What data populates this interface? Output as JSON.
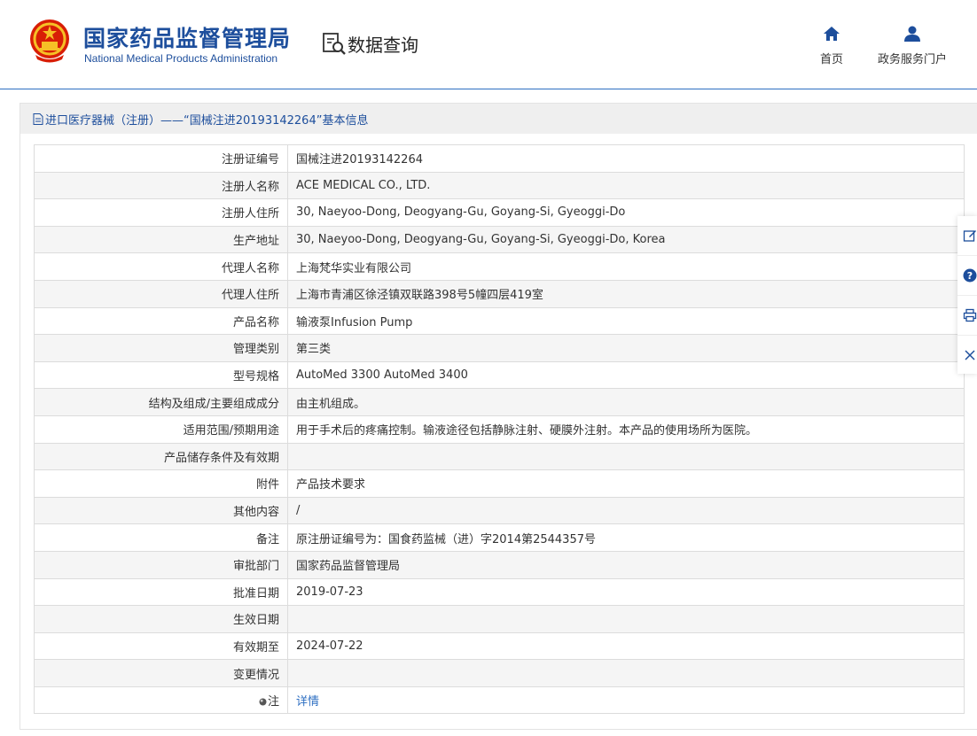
{
  "header": {
    "brand_cn": "国家药品监督管理局",
    "brand_en": "National Medical Products Administration",
    "query_label": "数据查询",
    "nav": [
      {
        "label": "首页",
        "icon": "home-icon"
      },
      {
        "label": "政务服务门户",
        "icon": "user-icon"
      }
    ]
  },
  "panel": {
    "title": "进口医疗器械（注册）——“国械注进20193142264”基本信息"
  },
  "rows": [
    {
      "label": "注册证编号",
      "value": "国械注进20193142264"
    },
    {
      "label": "注册人名称",
      "value": "ACE MEDICAL CO., LTD."
    },
    {
      "label": "注册人住所",
      "value": "30, Naeyoo-Dong, Deogyang-Gu, Goyang-Si, Gyeoggi-Do"
    },
    {
      "label": "生产地址",
      "value": "30, Naeyoo-Dong, Deogyang-Gu, Goyang-Si, Gyeoggi-Do, Korea"
    },
    {
      "label": "代理人名称",
      "value": "上海梵华实业有限公司"
    },
    {
      "label": "代理人住所",
      "value": "上海市青浦区徐泾镇双联路398号5幢四层419室"
    },
    {
      "label": "产品名称",
      "value": "输液泵Infusion Pump"
    },
    {
      "label": "管理类别",
      "value": "第三类"
    },
    {
      "label": "型号规格",
      "value": "AutoMed 3300 AutoMed 3400"
    },
    {
      "label": "结构及组成/主要组成成分",
      "value": "由主机组成。"
    },
    {
      "label": "适用范围/预期用途",
      "value": "用于手术后的疼痛控制。输液途径包括静脉注射、硬膜外注射。本产品的使用场所为医院。"
    },
    {
      "label": "产品储存条件及有效期",
      "value": ""
    },
    {
      "label": "附件",
      "value": "产品技术要求"
    },
    {
      "label": "其他内容",
      "value": "/"
    },
    {
      "label": "备注",
      "value": "原注册证编号为：国食药监械（进）字2014第2544357号"
    },
    {
      "label": "审批部门",
      "value": "国家药品监督管理局"
    },
    {
      "label": "批准日期",
      "value": "2019-07-23"
    },
    {
      "label": "生效日期",
      "value": ""
    },
    {
      "label": "有效期至",
      "value": "2024-07-22"
    },
    {
      "label": "变更情况",
      "value": ""
    }
  ],
  "note_row": {
    "label": "注",
    "link": "详情"
  },
  "sidebar": [
    "edit-icon",
    "help-icon",
    "print-icon",
    "close-icon"
  ],
  "colors": {
    "brand": "#1d4e9c",
    "link": "#2e6fc2",
    "stripe": "#f5f5f5"
  }
}
